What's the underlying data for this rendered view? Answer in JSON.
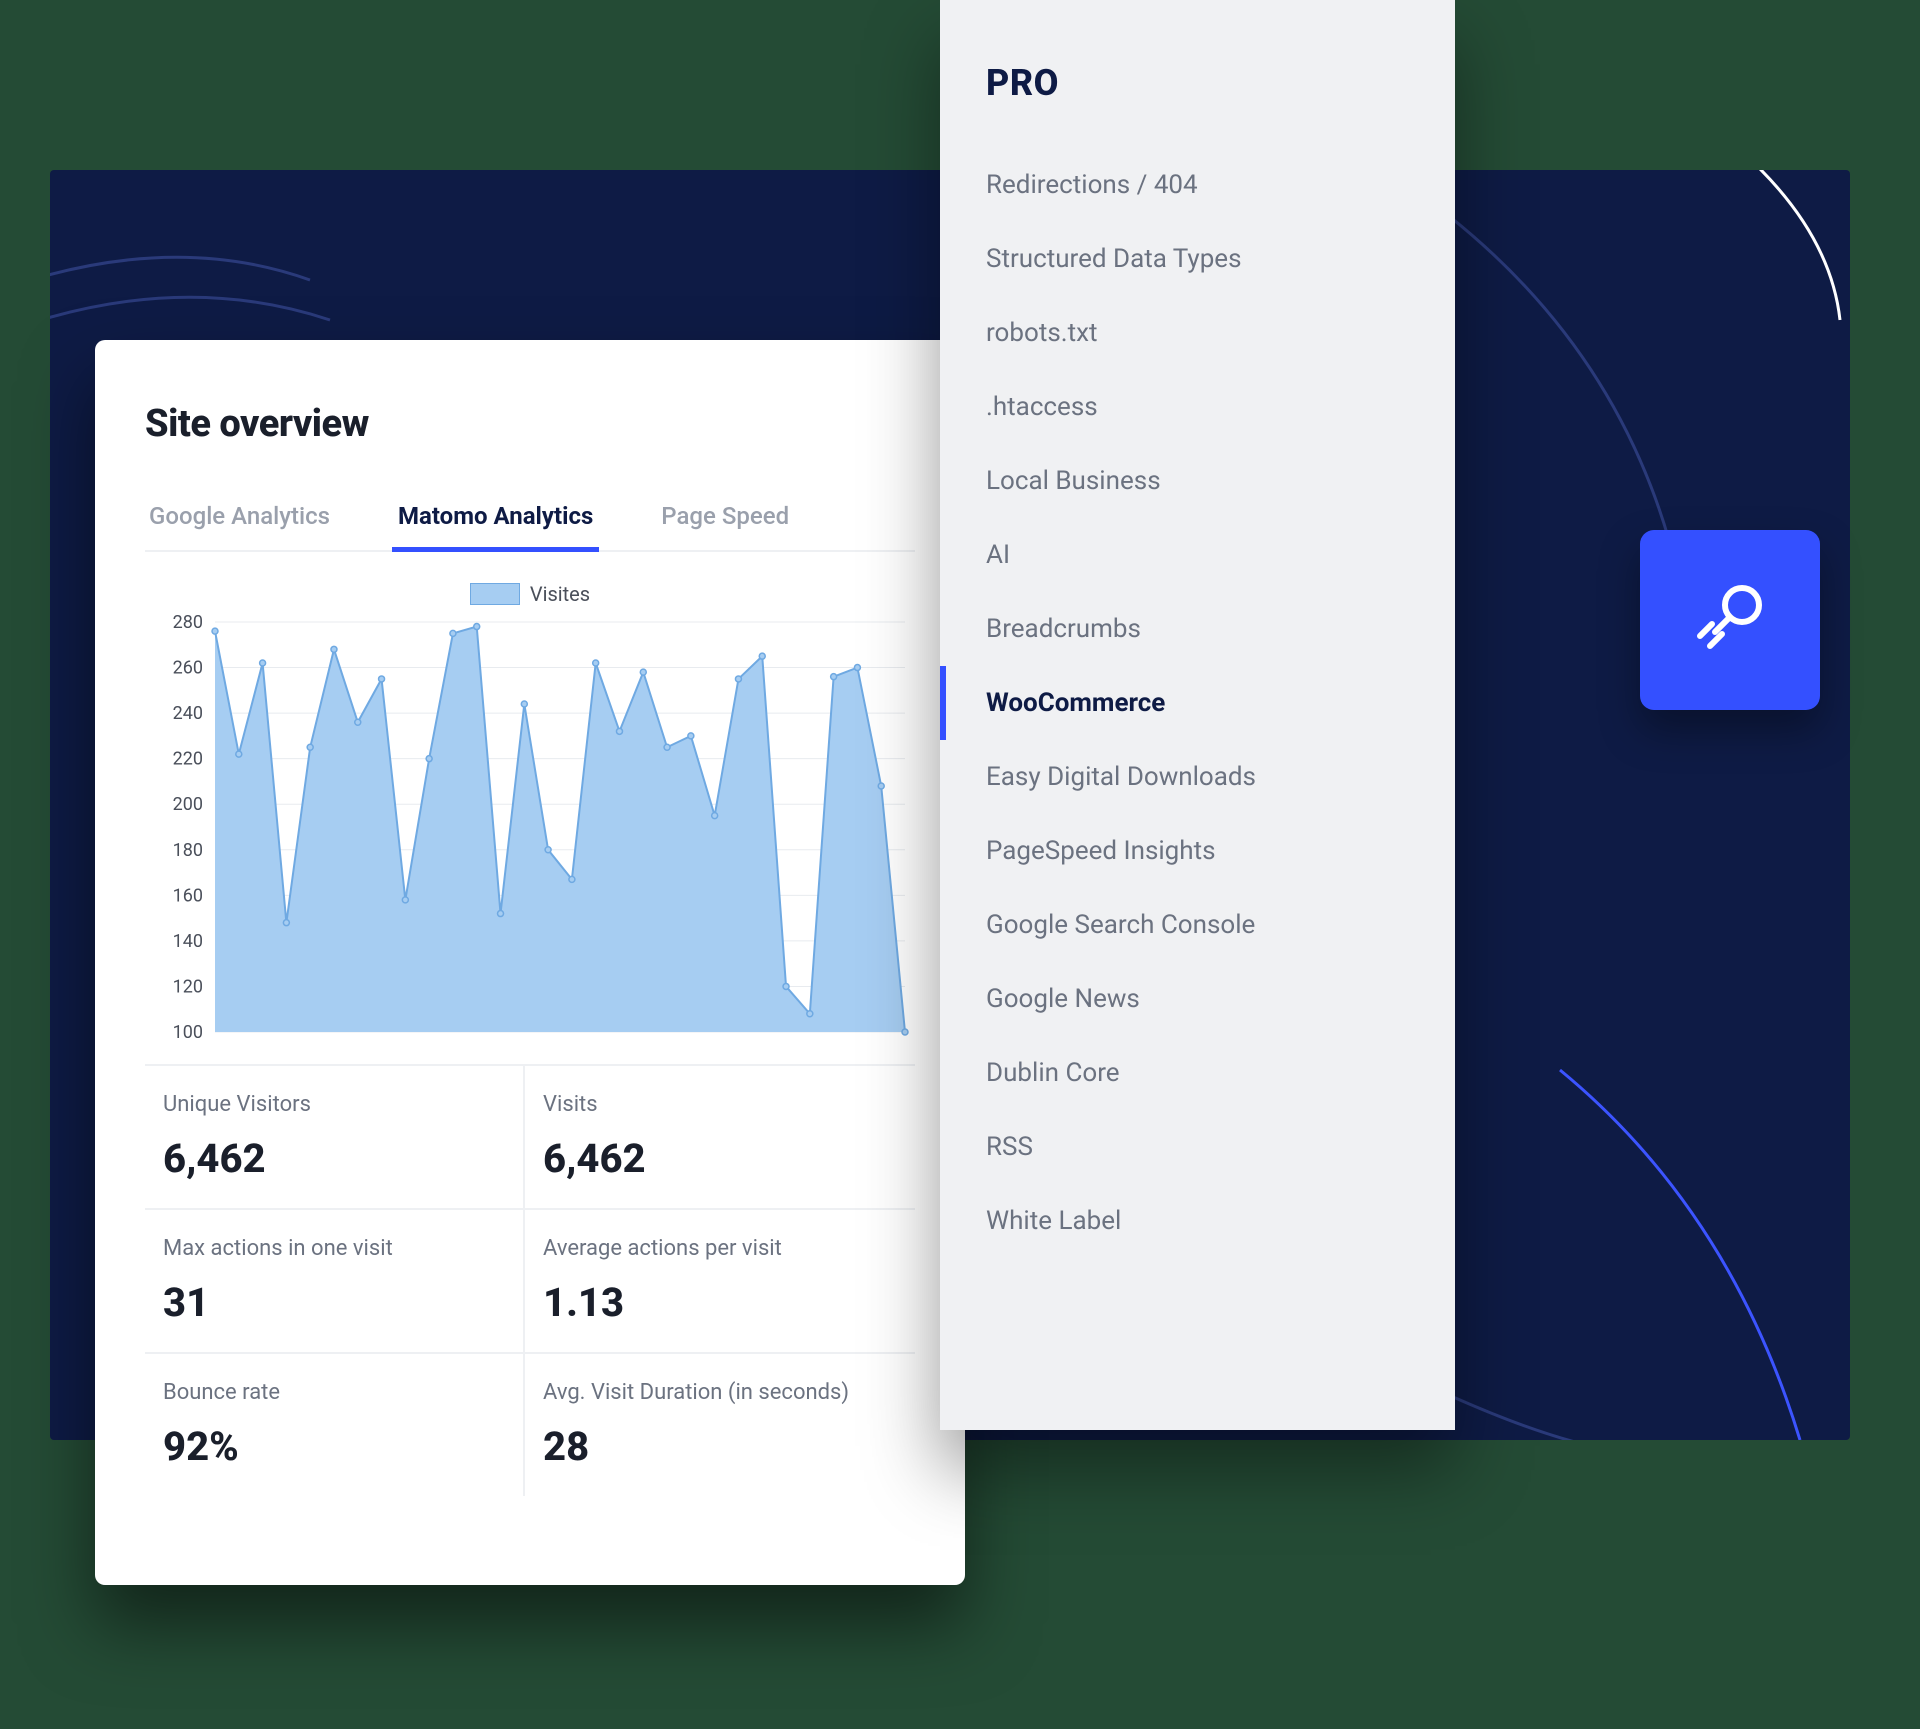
{
  "colors": {
    "accent": "#3450ff",
    "navy": "#0e1b45",
    "chart_fill": "#a6cdf2",
    "chart_stroke": "#6fa9e2"
  },
  "overview": {
    "title": "Site overview",
    "tabs": [
      {
        "label": "Google Analytics",
        "active": false
      },
      {
        "label": "Matomo Analytics",
        "active": true
      },
      {
        "label": "Page Speed",
        "active": false
      }
    ],
    "metrics": [
      {
        "label": "Unique Visitors",
        "value": "6,462"
      },
      {
        "label": "Visits",
        "value": "6,462"
      },
      {
        "label": "Max actions in one visit",
        "value": "31"
      },
      {
        "label": "Average actions per visit",
        "value": "1.13"
      },
      {
        "label": "Bounce rate",
        "value": "92%"
      },
      {
        "label": "Avg. Visit Duration (in seconds)",
        "value": "28"
      }
    ]
  },
  "pro": {
    "title": "PRO",
    "items": [
      "Redirections / 404",
      "Structured Data Types",
      "robots.txt",
      ".htaccess",
      "Local Business",
      "AI",
      "Breadcrumbs",
      "WooCommerce",
      "Easy Digital Downloads",
      "PageSpeed Insights",
      "Google Search Console",
      "Google News",
      "Dublin Core",
      "RSS",
      "White Label"
    ],
    "selected_index": 7
  },
  "chart_data": {
    "type": "area",
    "title": "",
    "legend": "Visites",
    "ylabel": "",
    "ylim": [
      100,
      280
    ],
    "yticks": [
      100,
      120,
      140,
      160,
      180,
      200,
      220,
      240,
      260,
      280
    ],
    "x": [
      0,
      1,
      2,
      3,
      4,
      5,
      6,
      7,
      8,
      9,
      10,
      11,
      12,
      13,
      14,
      15,
      16,
      17,
      18,
      19,
      20,
      21,
      22,
      23,
      24,
      25,
      26,
      27,
      28,
      29
    ],
    "values": [
      276,
      222,
      262,
      148,
      225,
      268,
      236,
      255,
      158,
      220,
      275,
      278,
      152,
      244,
      180,
      167,
      262,
      232,
      258,
      225,
      230,
      195,
      255,
      265,
      120,
      108,
      256,
      260,
      208,
      100
    ]
  }
}
